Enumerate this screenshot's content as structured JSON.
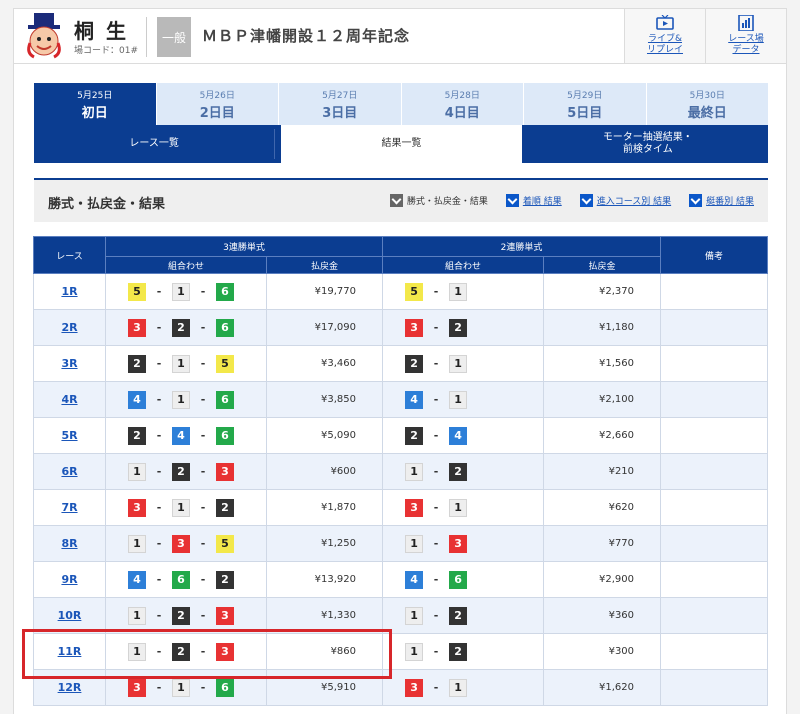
{
  "header": {
    "venue_name": "桐生",
    "venue_code": "場コード：01#",
    "grade": "一般",
    "race_title": "ＭＢＰ津幡開設１２周年記念",
    "buttons": [
      {
        "label": "ライブ&\nリプレイ",
        "icon": "tv-icon"
      },
      {
        "label": "レース場\nデータ",
        "icon": "chart-icon"
      }
    ]
  },
  "day_tabs": [
    {
      "date": "5月25日",
      "label": "初日",
      "active": true
    },
    {
      "date": "5月26日",
      "label": "2日目",
      "active": false
    },
    {
      "date": "5月27日",
      "label": "3日目",
      "active": false
    },
    {
      "date": "5月28日",
      "label": "4日目",
      "active": false
    },
    {
      "date": "5月29日",
      "label": "5日目",
      "active": false
    },
    {
      "date": "5月30日",
      "label": "最終日",
      "active": false
    }
  ],
  "sub_tabs": [
    {
      "label": "レース一覧",
      "active": false
    },
    {
      "label": "結果一覧",
      "active": true
    },
    {
      "label": "モーター抽選結果・\n前検タイム",
      "active": false
    }
  ],
  "section": {
    "title": "勝式・払戻金・結果",
    "filters": [
      {
        "label": "勝式・払戻金・結果",
        "style": "gray"
      },
      {
        "label": "着順 結果",
        "style": "blue"
      },
      {
        "label": "進入コース別 結果",
        "style": "blue"
      },
      {
        "label": "艇番別 結果",
        "style": "blue"
      }
    ]
  },
  "table": {
    "headers": {
      "race": "レース",
      "trifecta": "3連勝単式",
      "exacta": "2連勝単式",
      "note": "備考",
      "combo": "組合わせ",
      "payout": "払戻金"
    },
    "rows": [
      {
        "race": "1R",
        "tri": [
          5,
          1,
          6
        ],
        "tri_pay": "¥19,770",
        "ex": [
          5,
          1
        ],
        "ex_pay": "¥2,370"
      },
      {
        "race": "2R",
        "tri": [
          3,
          2,
          6
        ],
        "tri_pay": "¥17,090",
        "ex": [
          3,
          2
        ],
        "ex_pay": "¥1,180"
      },
      {
        "race": "3R",
        "tri": [
          2,
          1,
          5
        ],
        "tri_pay": "¥3,460",
        "ex": [
          2,
          1
        ],
        "ex_pay": "¥1,560"
      },
      {
        "race": "4R",
        "tri": [
          4,
          1,
          6
        ],
        "tri_pay": "¥3,850",
        "ex": [
          4,
          1
        ],
        "ex_pay": "¥2,100"
      },
      {
        "race": "5R",
        "tri": [
          2,
          4,
          6
        ],
        "tri_pay": "¥5,090",
        "ex": [
          2,
          4
        ],
        "ex_pay": "¥2,660"
      },
      {
        "race": "6R",
        "tri": [
          1,
          2,
          3
        ],
        "tri_pay": "¥600",
        "ex": [
          1,
          2
        ],
        "ex_pay": "¥210"
      },
      {
        "race": "7R",
        "tri": [
          3,
          1,
          2
        ],
        "tri_pay": "¥1,870",
        "ex": [
          3,
          1
        ],
        "ex_pay": "¥620"
      },
      {
        "race": "8R",
        "tri": [
          1,
          3,
          5
        ],
        "tri_pay": "¥1,250",
        "ex": [
          1,
          3
        ],
        "ex_pay": "¥770"
      },
      {
        "race": "9R",
        "tri": [
          4,
          6,
          2
        ],
        "tri_pay": "¥13,920",
        "ex": [
          4,
          6
        ],
        "ex_pay": "¥2,900"
      },
      {
        "race": "10R",
        "tri": [
          1,
          2,
          3
        ],
        "tri_pay": "¥1,330",
        "ex": [
          1,
          2
        ],
        "ex_pay": "¥360"
      },
      {
        "race": "11R",
        "tri": [
          1,
          2,
          3
        ],
        "tri_pay": "¥860",
        "ex": [
          1,
          2
        ],
        "ex_pay": "¥300"
      },
      {
        "race": "12R",
        "tri": [
          3,
          1,
          6
        ],
        "tri_pay": "¥5,910",
        "ex": [
          3,
          1
        ],
        "ex_pay": "¥1,620"
      }
    ]
  },
  "colors": {
    "navy": "#0b3d91",
    "boat_1": "#eeeeee",
    "boat_2": "#333333",
    "boat_3": "#e83233",
    "boat_4": "#2d7fd8",
    "boat_5": "#f3e84a",
    "boat_6": "#23a94a",
    "highlight": "#d7262a"
  }
}
